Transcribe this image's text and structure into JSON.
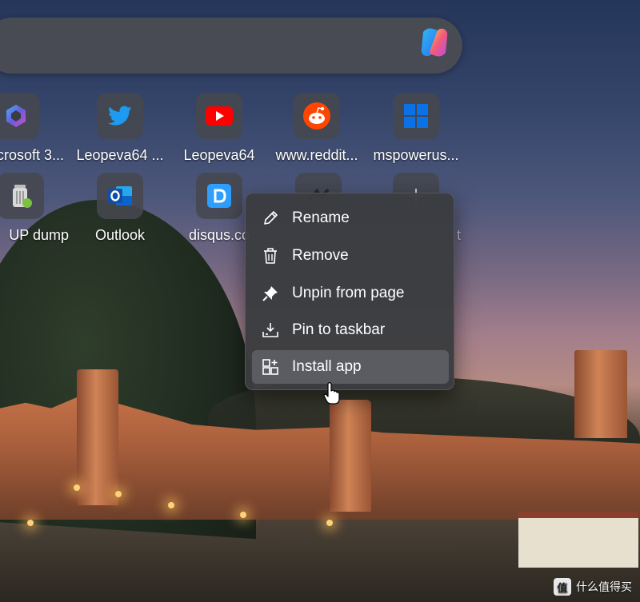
{
  "tiles": [
    {
      "label": "crosoft 3...",
      "icon": "microsoft-365-icon"
    },
    {
      "label": "Leopeva64 ...",
      "icon": "twitter-icon"
    },
    {
      "label": "Leopeva64",
      "icon": "youtube-icon"
    },
    {
      "label": "www.reddit...",
      "icon": "reddit-icon"
    },
    {
      "label": "mspowerus...",
      "icon": "windows-icon"
    },
    {
      "label": "UP dump",
      "icon": "trash-can-icon"
    },
    {
      "label": "Outlook",
      "icon": "outlook-icon"
    },
    {
      "label": "disqus.co",
      "icon": "disqus-icon"
    },
    {
      "label": "",
      "icon": "site-icon"
    },
    {
      "label": "t",
      "icon": "add-icon"
    }
  ],
  "context_menu": {
    "items": [
      {
        "label": "Rename",
        "icon": "pencil-icon"
      },
      {
        "label": "Remove",
        "icon": "trash-icon"
      },
      {
        "label": "Unpin from page",
        "icon": "unpin-icon"
      },
      {
        "label": "Pin to taskbar",
        "icon": "pin-taskbar-icon"
      },
      {
        "label": "Install app",
        "icon": "install-app-icon",
        "highlighted": true
      }
    ]
  },
  "watermark": {
    "badge": "值",
    "text": "什么值得买"
  },
  "colors": {
    "tile_bg": "#46484e",
    "menu_bg": "#3a3c40",
    "menu_hover": "#5c5e63",
    "twitter": "#1d9bf0",
    "youtube": "#ff0000",
    "reddit": "#ff4500",
    "outlook": "#0a64c9",
    "disqus": "#2e9fff"
  }
}
